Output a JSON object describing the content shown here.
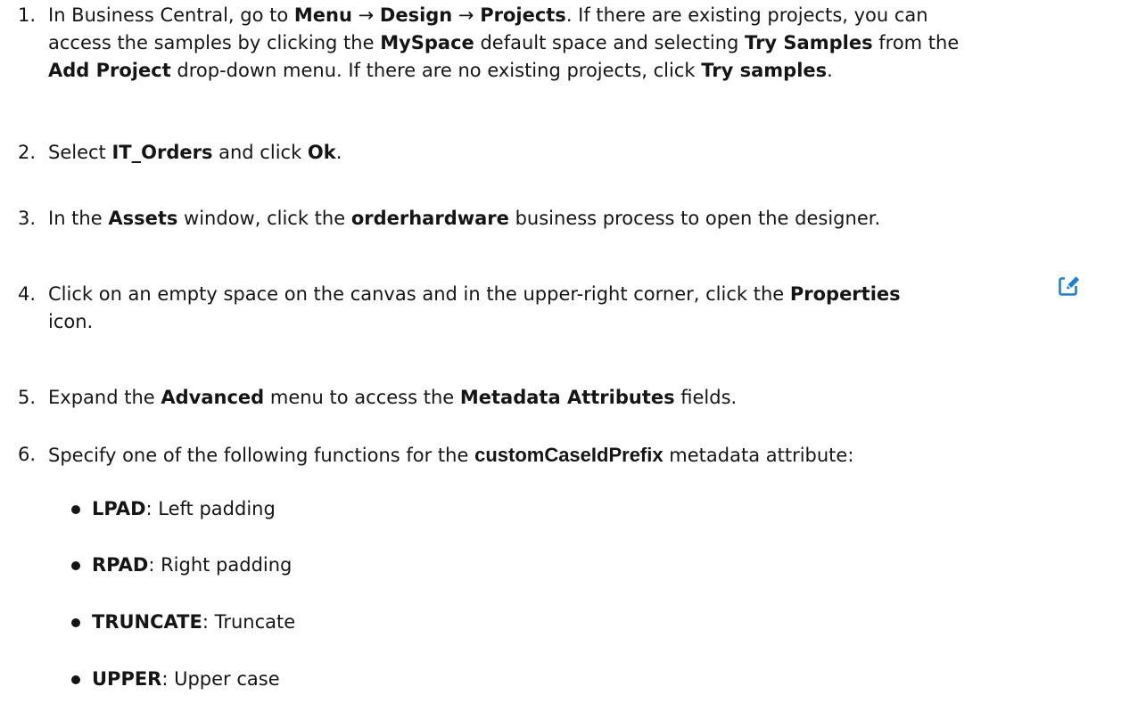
{
  "steps": [
    {
      "num": "1.",
      "line1": [
        "In Business Central, go to ",
        "Menu",
        " → ",
        "Design",
        " → ",
        "Projects",
        ". If there are existing projects, you can"
      ],
      "line2": [
        "access the samples by clicking the ",
        "MySpace",
        " default space and selecting ",
        "Try Samples",
        " from the"
      ],
      "line3": [
        "Add Project",
        " drop-down menu. If there are no existing projects, click ",
        "Try samples",
        "."
      ]
    },
    {
      "num": "2.",
      "parts": [
        "Select ",
        "IT_Orders",
        " and click ",
        "Ok",
        "."
      ]
    },
    {
      "num": "3.",
      "parts": [
        "In the ",
        "Assets",
        " window, click the ",
        "orderhardware",
        " business process to open the designer."
      ]
    },
    {
      "num": "4.",
      "line1": [
        "Click on an empty space on the canvas and in the upper-right corner, click the ",
        "Properties"
      ],
      "line2": "icon."
    },
    {
      "num": "5.",
      "parts": [
        "Expand the ",
        "Advanced",
        " menu to access the ",
        "Metadata Attributes",
        " fields."
      ]
    },
    {
      "num": "6.",
      "parts": [
        "Specify one of the following functions for the ",
        "customCaseIdPrefix",
        " metadata attribute:"
      ]
    }
  ],
  "functions": [
    {
      "name": "LPAD",
      "desc": ": Left padding"
    },
    {
      "name": "RPAD",
      "desc": ": Right padding"
    },
    {
      "name": "TRUNCATE",
      "desc": ": Truncate"
    },
    {
      "name": "UPPER",
      "desc": ": Upper case"
    }
  ],
  "icons": {
    "properties": "edit-icon"
  },
  "colors": {
    "icon_blue": "#1b7fd6",
    "text": "#151515"
  }
}
